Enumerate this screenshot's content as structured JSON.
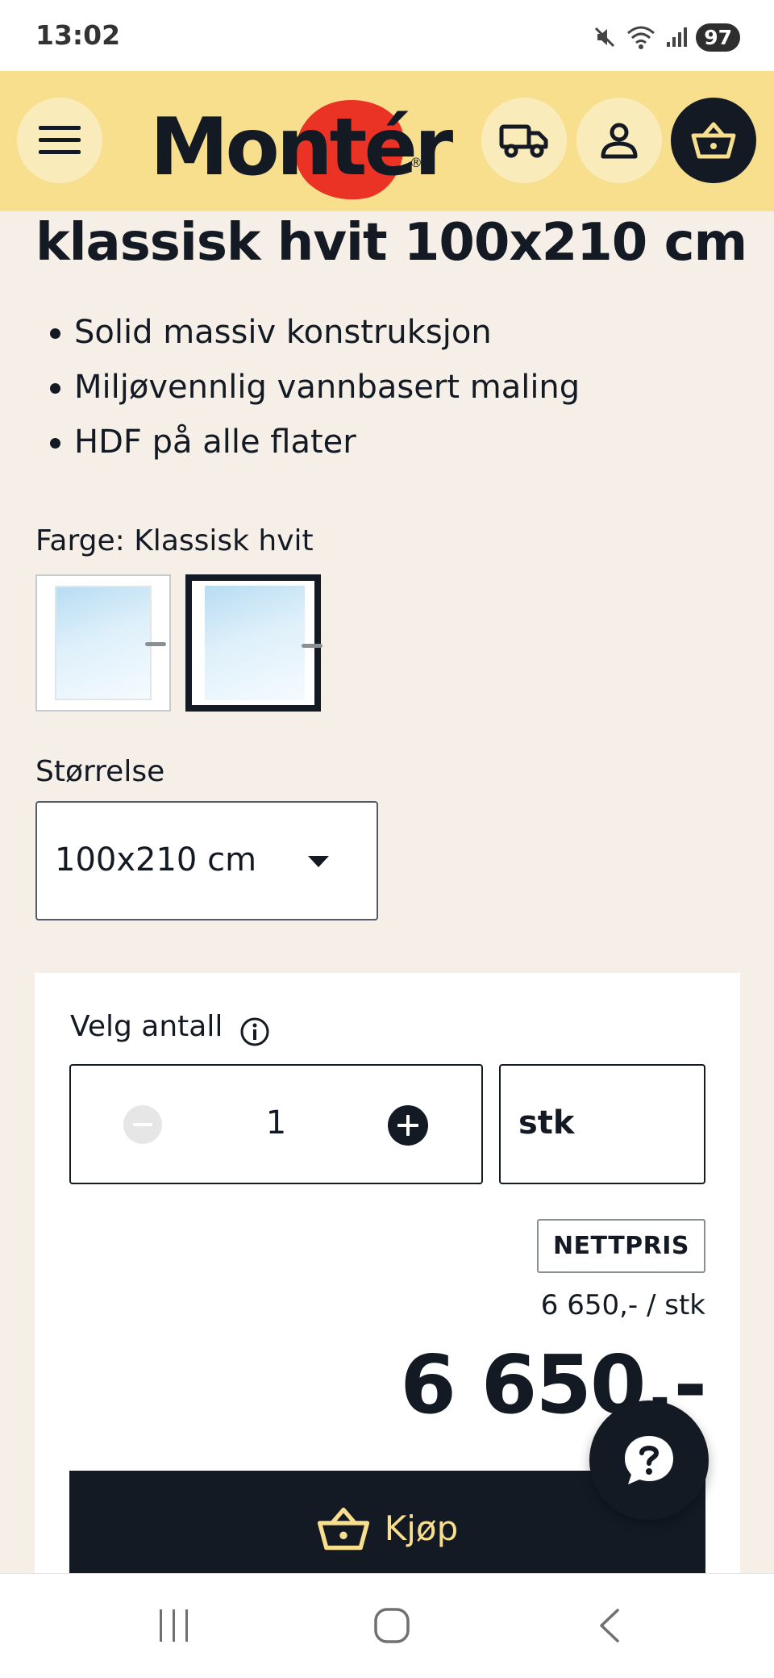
{
  "status_bar": {
    "time": "13:02",
    "battery": "97",
    "icons": [
      "mute-icon",
      "wifi-icon",
      "signal-icon",
      "battery-icon"
    ]
  },
  "header": {
    "logo_text": "Montér",
    "icons": [
      "menu-icon",
      "truck-icon",
      "user-icon",
      "basket-icon"
    ],
    "brand_colors": {
      "header_bg": "#f7df8e",
      "logo_red": "#ea3325",
      "dark": "#141a24"
    }
  },
  "product": {
    "title": "klassisk hvit 100x210 cm",
    "features": [
      "Solid massiv konstruksjon",
      "Miljøvennlig vannbasert maling",
      "HDF på alle flater"
    ],
    "color_label": "Farge: Klassisk hvit",
    "color_options": [
      {
        "name": "swatch-white-frame",
        "selected": false
      },
      {
        "name": "swatch-classic-white",
        "selected": true
      }
    ],
    "size_label": "Størrelse",
    "size_value": "100x210 cm"
  },
  "purchase": {
    "quantity_label": "Velg antall",
    "quantity": "1",
    "unit": "stk",
    "badge": "NETTPRIS",
    "unit_price": "6 650,- / stk",
    "total_price": "6 650,-",
    "buy_label": "Kjøp"
  },
  "help": {
    "icon": "question-chat-icon"
  },
  "nav": {
    "icons": [
      "recent-apps-icon",
      "home-icon",
      "back-icon"
    ]
  }
}
